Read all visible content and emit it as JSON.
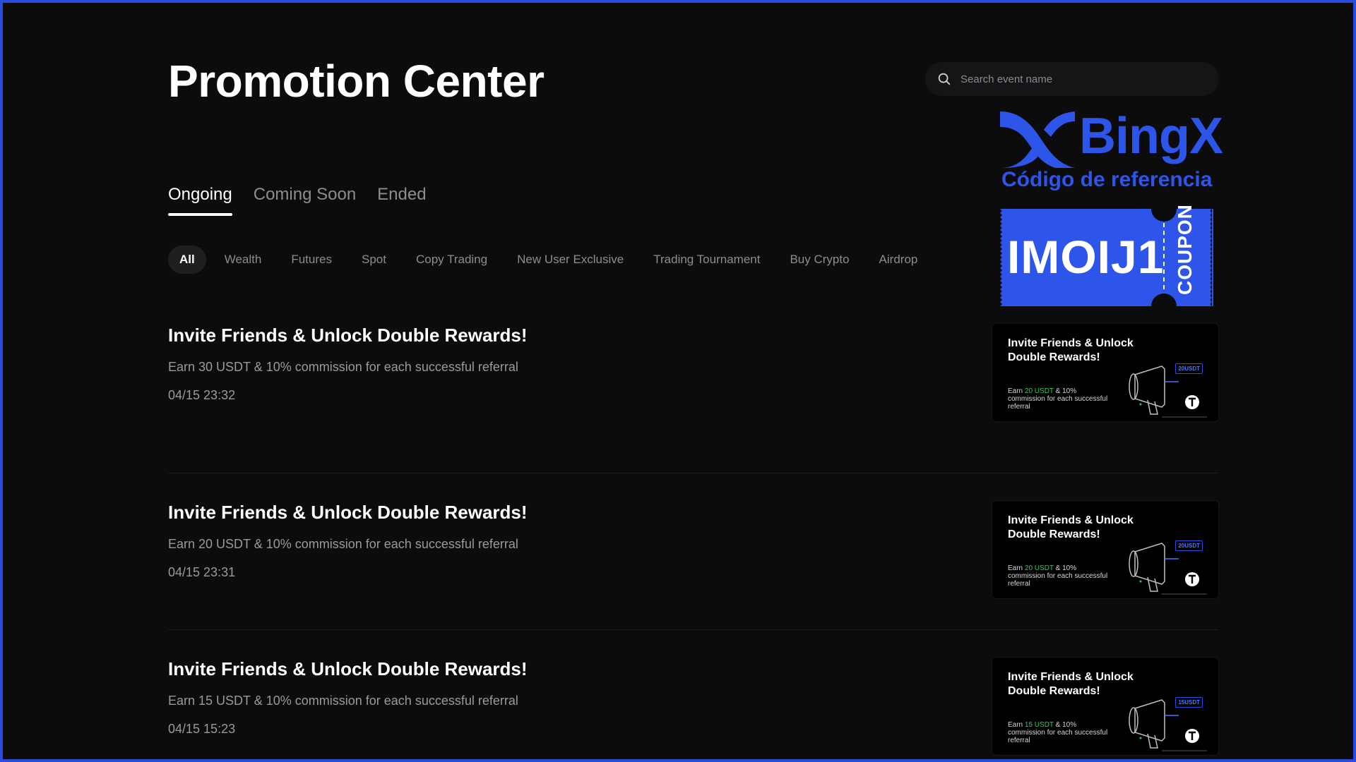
{
  "page": {
    "title": "Promotion Center"
  },
  "search": {
    "placeholder": "Search event name"
  },
  "tabs": [
    {
      "label": "Ongoing",
      "active": true
    },
    {
      "label": "Coming Soon",
      "active": false
    },
    {
      "label": "Ended",
      "active": false
    }
  ],
  "filters": [
    {
      "label": "All",
      "active": true
    },
    {
      "label": "Wealth"
    },
    {
      "label": "Futures"
    },
    {
      "label": "Spot"
    },
    {
      "label": "Copy Trading"
    },
    {
      "label": "New User Exclusive"
    },
    {
      "label": "Trading Tournament"
    },
    {
      "label": "Buy Crypto"
    },
    {
      "label": "Airdrop"
    }
  ],
  "events": [
    {
      "title": "Invite Friends & Unlock Double Rewards!",
      "description": "Earn 30 USDT & 10% commission for each successful referral",
      "date": "04/15 23:32",
      "banner": {
        "title": "Invite Friends & Unlock Double Rewards!",
        "earn": "Earn",
        "amount": "20 USDT",
        "rest": "& 10% commission for each successful referral",
        "badge": "20USDT"
      }
    },
    {
      "title": "Invite Friends & Unlock Double Rewards!",
      "description": "Earn 20 USDT & 10% commission for each successful referral",
      "date": "04/15 23:31",
      "banner": {
        "title": "Invite Friends & Unlock Double Rewards!",
        "earn": "Earn",
        "amount": "20 USDT",
        "rest": "& 10% commission for each successful referral",
        "badge": "20USDT"
      }
    },
    {
      "title": "Invite Friends & Unlock Double Rewards!",
      "description": "Earn 15 USDT & 10% commission for each successful referral",
      "date": "04/15 15:23",
      "banner": {
        "title": "Invite Friends & Unlock Double Rewards!",
        "earn": "Earn",
        "amount": "15 USDT",
        "rest": "& 10% commission for each successful referral",
        "badge": "15USDT"
      }
    }
  ],
  "overlay": {
    "brand": "BingX",
    "subtitle": "Código de referencia",
    "coupon_code": "IMOIJ1",
    "coupon_word": "COUPON"
  },
  "colors": {
    "brand_blue": "#2d55ea",
    "background": "#0c0c0d",
    "highlight_green": "#2ecc5a"
  },
  "icons": {
    "search": "search-icon",
    "megaphone": "megaphone-icon",
    "tether": "tether-icon",
    "logo": "bingx-logo-icon"
  }
}
